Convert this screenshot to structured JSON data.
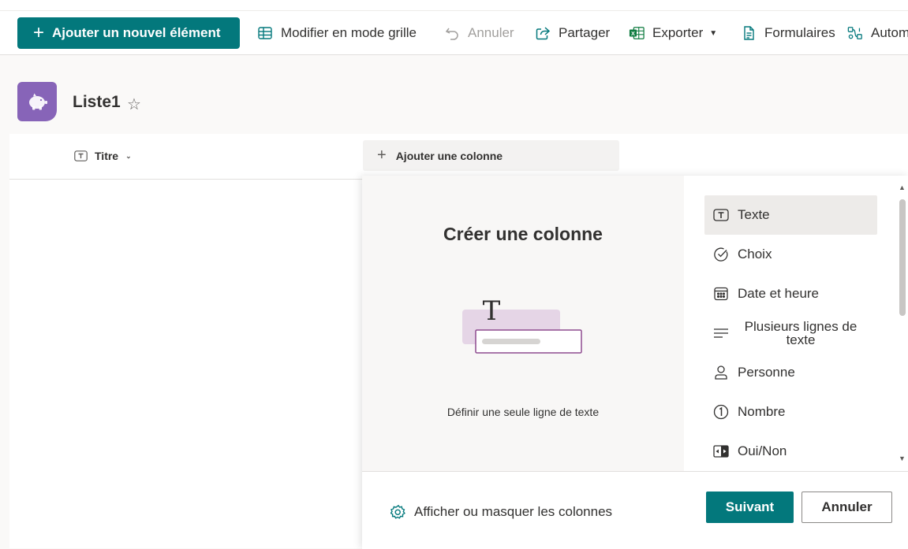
{
  "colors": {
    "accent": "#03787c",
    "list_icon_bg": "#8764b8"
  },
  "command_bar": {
    "new_item_label": "Ajouter un nouvel élément",
    "grid_edit_label": "Modifier en mode grille",
    "undo_label": "Annuler",
    "share_label": "Partager",
    "export_label": "Exporter",
    "forms_label": "Formulaires",
    "automate_label": "Autom"
  },
  "list": {
    "title": "Liste1"
  },
  "columns": {
    "title_label": "Titre",
    "add_column_label": "Ajouter une colonne"
  },
  "create_panel": {
    "title": "Créer une colonne",
    "description": "Définir une seule ligne de texte",
    "types": [
      {
        "label": "Texte",
        "icon": "text-icon",
        "selected": true
      },
      {
        "label": "Choix",
        "icon": "checkmark-circle-icon"
      },
      {
        "label": "Date et heure",
        "icon": "calendar-icon"
      },
      {
        "label": "Plusieurs lignes de texte",
        "icon": "multiline-text-icon"
      },
      {
        "label": "Personne",
        "icon": "person-icon"
      },
      {
        "label": "Nombre",
        "icon": "number-icon"
      },
      {
        "label": "Oui/Non",
        "icon": "toggle-icon"
      }
    ],
    "show_hide_label": "Afficher ou masquer les colonnes",
    "next_label": "Suivant",
    "cancel_label": "Annuler"
  }
}
